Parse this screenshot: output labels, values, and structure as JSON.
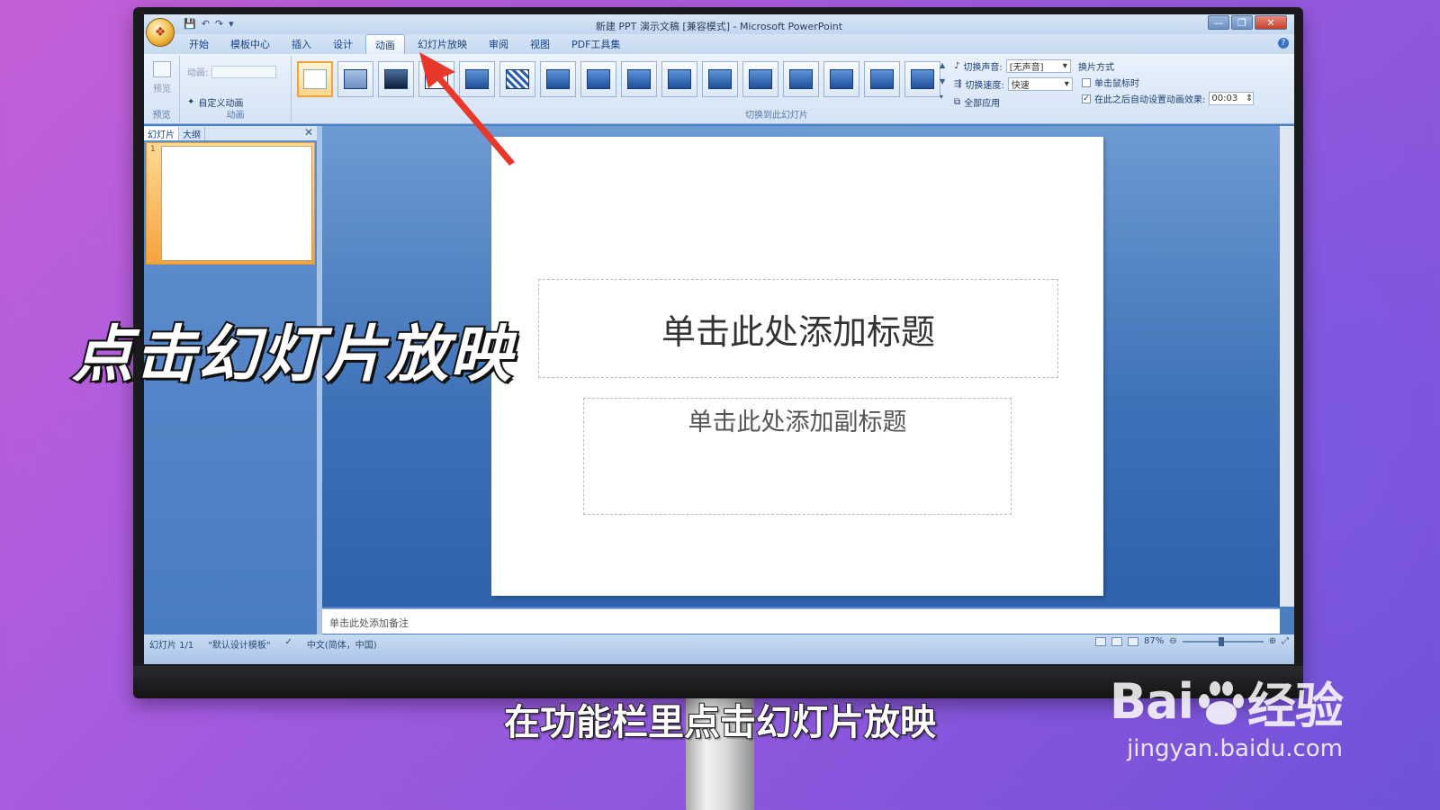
{
  "app": {
    "title": "新建 PPT 演示文稿 [兼容模式] - Microsoft PowerPoint",
    "office_button_glyph": "❖",
    "qat": [
      "💾",
      "↶",
      "↷",
      "▾"
    ],
    "window_controls": [
      "—",
      "❐",
      "✕"
    ]
  },
  "tabs": [
    {
      "label": "开始",
      "active": false
    },
    {
      "label": "模板中心",
      "active": false
    },
    {
      "label": "插入",
      "active": false
    },
    {
      "label": "设计",
      "active": false
    },
    {
      "label": "动画",
      "active": true
    },
    {
      "label": "幻灯片放映",
      "active": false
    },
    {
      "label": "审阅",
      "active": false
    },
    {
      "label": "视图",
      "active": false
    },
    {
      "label": "PDF工具集",
      "active": false
    }
  ],
  "ribbon": {
    "preview": {
      "label": "预览",
      "group_label": "预览"
    },
    "animation": {
      "anim_label": "动画:",
      "custom_label": "自定义动画",
      "group_label": "动画"
    },
    "transition": {
      "group_label": "切换到此幻灯片",
      "sound_label": "切换声音:",
      "sound_value": "[无声音]",
      "speed_label": "切换速度:",
      "speed_value": "快速",
      "apply_all": "全部应用",
      "advance_title": "换片方式",
      "on_click_label": "单击鼠标时",
      "auto_label": "在此之后自动设置动画效果:",
      "auto_value": "00:03"
    }
  },
  "left_pane": {
    "tabs": [
      "幻灯片",
      "大纲"
    ],
    "close": "✕",
    "slide_number": "1"
  },
  "slide": {
    "title_placeholder": "单击此处添加标题",
    "subtitle_placeholder": "单击此处添加副标题"
  },
  "notes_placeholder": "单击此处添加备注",
  "status": {
    "slide_info": "幻灯片 1/1",
    "theme": "\"默认设计模板\"",
    "language": "中文(简体，中国)",
    "zoom": "87%"
  },
  "overlay": {
    "caption": "点击幻灯片放映",
    "subtitle": "在功能栏里点击幻灯片放映"
  },
  "watermark": {
    "logo_text_1": "Bai",
    "logo_text_2": "经验",
    "url": "jingyan.baidu.com"
  },
  "colors": {
    "accent_arrow": "#e8382c",
    "selected_gallery": "#f2a33a"
  }
}
